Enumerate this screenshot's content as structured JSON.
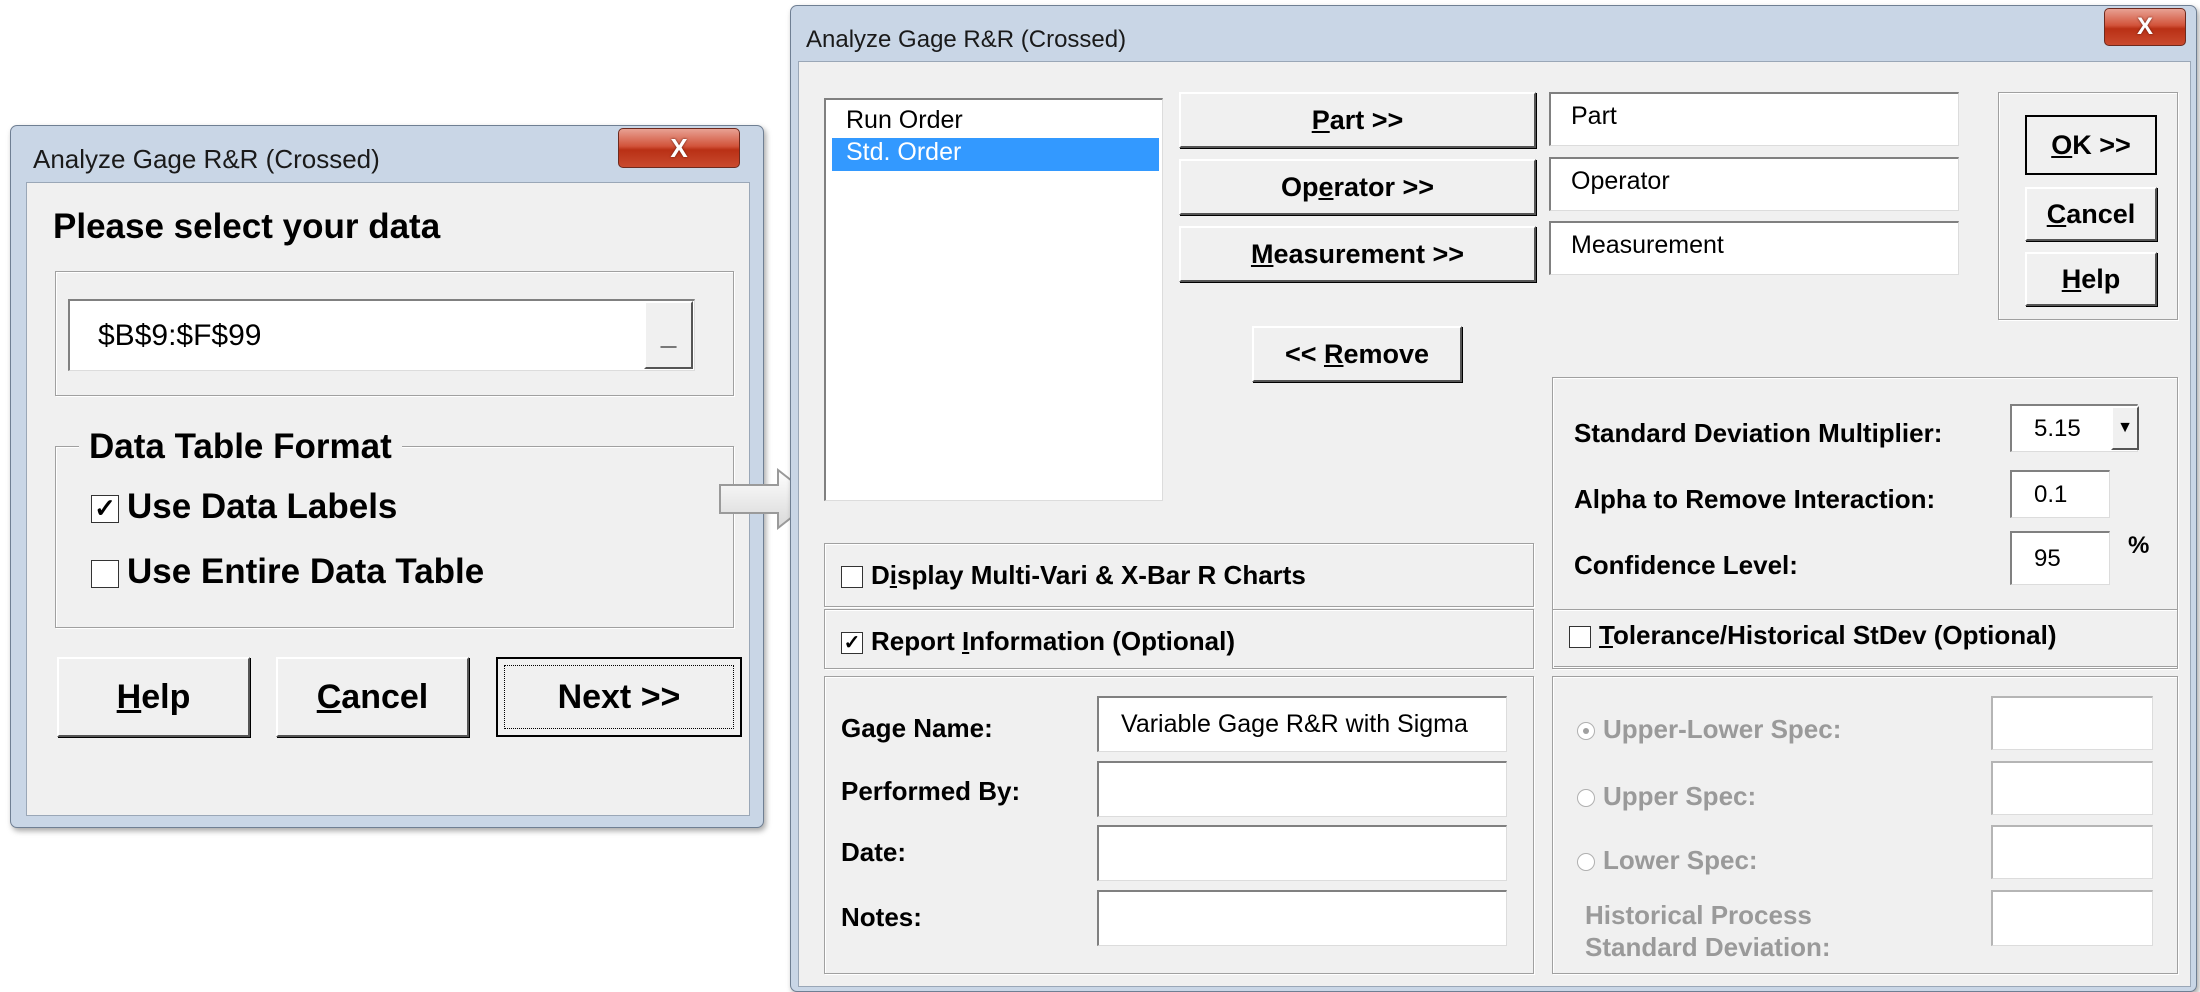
{
  "small_dialog": {
    "title": "Analyze Gage R&R (Crossed)",
    "close_label": "X",
    "prompt": "Please select your data",
    "range_value": "$B$9:$F$99",
    "range_button_label": "_",
    "format_group_label": "Data Table Format",
    "use_data_labels": {
      "label": "Use Data Labels",
      "checked": true
    },
    "use_entire_table": {
      "label": "Use Entire Data Table",
      "checked": false
    },
    "help_label": "Help",
    "cancel_label": "Cancel",
    "next_label": "Next >>"
  },
  "main_dialog": {
    "title": "Analyze Gage R&R (Crossed)",
    "close_label": "X",
    "variables": [
      {
        "label": "Run Order",
        "selected": false
      },
      {
        "label": "Std. Order",
        "selected": true
      }
    ],
    "assign": {
      "part_button": "Part >>",
      "operator_button": "Operator >>",
      "measurement_button": "Measurement >>",
      "remove_button": "<< Remove",
      "part_value": "Part",
      "operator_value": "Operator",
      "measurement_value": "Measurement"
    },
    "actions": {
      "ok": "OK >>",
      "cancel": "Cancel",
      "help": "Help"
    },
    "options": {
      "std_dev_multiplier_label": "Standard Deviation Multiplier:",
      "std_dev_multiplier_value": "5.15",
      "alpha_label": "Alpha to Remove Interaction:",
      "alpha_value": "0.1",
      "confidence_label": "Confidence Level:",
      "confidence_value": "95",
      "percent_sign": "%"
    },
    "display_charts": {
      "label": "Display Multi-Vari & X-Bar R Charts",
      "checked": false
    },
    "report_info": {
      "label": "Report Information (Optional)",
      "checked": true
    },
    "report_fields": {
      "gage_name_label": "Gage Name:",
      "gage_name_value": "Variable Gage R&R with Sigma",
      "performed_by_label": "Performed By:",
      "performed_by_value": "",
      "date_label": "Date:",
      "date_value": "",
      "notes_label": "Notes:",
      "notes_value": ""
    },
    "tolerance": {
      "label": "Tolerance/Historical StDev (Optional)",
      "checked": false,
      "upper_lower_label": "Upper-Lower Spec:",
      "upper_label": "Upper Spec:",
      "lower_label": "Lower Spec:",
      "historical_label_line1": "Historical Process",
      "historical_label_line2": "Standard Deviation:"
    }
  }
}
